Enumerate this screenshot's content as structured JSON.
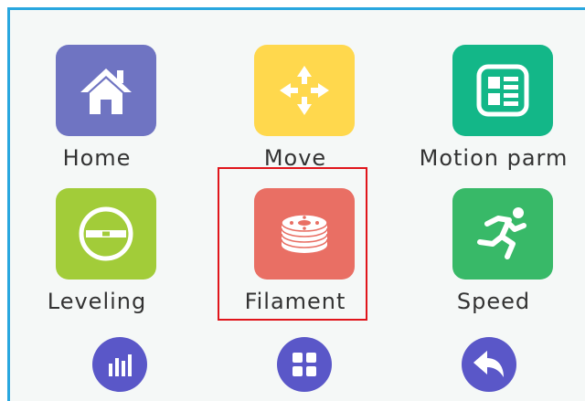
{
  "menu": {
    "tiles": [
      {
        "label": "Home",
        "icon": "home-icon",
        "color": "#6f74c2"
      },
      {
        "label": "Move",
        "icon": "move-arrows-icon",
        "color": "#ffd84d"
      },
      {
        "label": "Motion parm",
        "icon": "motion-parameters-icon",
        "color": "#13b788"
      },
      {
        "label": "Leveling",
        "icon": "spirit-level-icon",
        "color": "#a2cc39"
      },
      {
        "label": "Filament",
        "icon": "filament-spool-icon",
        "color": "#e96f64"
      },
      {
        "label": "Speed",
        "icon": "running-person-icon",
        "color": "#38b968"
      }
    ],
    "selected": "Filament",
    "selection_color": "#e0151b"
  },
  "bottom_bar": {
    "buttons": [
      {
        "icon": "bar-chart-icon"
      },
      {
        "icon": "grid-icon"
      },
      {
        "icon": "back-arrow-icon"
      }
    ],
    "color": "#5a57c8"
  },
  "frame": {
    "border_color": "#29a7df",
    "background": "#f5f8f7"
  }
}
